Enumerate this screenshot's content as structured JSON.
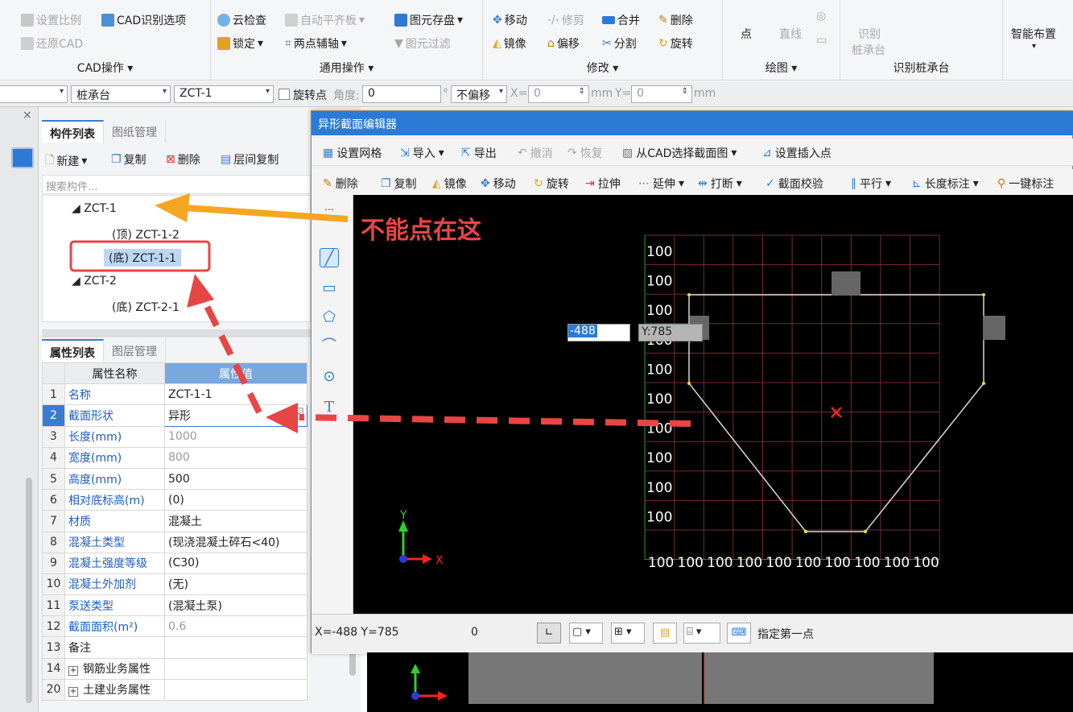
{
  "ribbon": {
    "cad_ops": {
      "set_scale": "设置比例",
      "cad_recognize_options": "CAD识别选项",
      "restore_cad": "还原CAD",
      "title": "CAD操作"
    },
    "common_ops": {
      "cloud_check": "云检查",
      "auto_align_slab": "自动平齐板",
      "lock": "锁定",
      "two_point_axis": "两点辅轴",
      "element_save": "图元存盘",
      "element_filter": "图元过滤",
      "title": "通用操作"
    },
    "modify": {
      "move": "移动",
      "trim": "修剪",
      "merge": "合并",
      "delete": "删除",
      "mirror": "镜像",
      "offset": "偏移",
      "split": "分割",
      "rotate": "旋转",
      "title": "修改"
    },
    "draw": {
      "point": "点",
      "line": "直线",
      "title": "绘图"
    },
    "recognize_cap": {
      "recognize": "识别",
      "pile_cap": "桩承台",
      "title": "识别桩承台"
    },
    "smart_layout": "智能布置"
  },
  "toolbar2": {
    "category": "桩承台",
    "element": "ZCT-1",
    "rotate_point": "旋转点",
    "angle_label": "角度:",
    "angle_value": "0",
    "degree": "°",
    "offset": "不偏移",
    "x_label": "X=",
    "x_value": "0",
    "mm1": "mm",
    "y_label": "Y=",
    "y_value": "0",
    "mm2": "mm"
  },
  "component_panel": {
    "tab_active": "构件列表",
    "tab_other": "图纸管理",
    "new": "新建",
    "copy": "复制",
    "delete": "删除",
    "layer_copy": "层间复制",
    "search_placeholder": "搜索构件...",
    "tree": [
      {
        "label": "ZCT-1"
      },
      {
        "label": "(顶) ZCT-1-2"
      },
      {
        "label": "(底) ZCT-1-1"
      },
      {
        "label": "ZCT-2"
      },
      {
        "label": "(底) ZCT-2-1"
      }
    ]
  },
  "property_panel": {
    "tab_active": "属性列表",
    "tab_other": "图层管理",
    "col_name": "属性名称",
    "col_value": "属性值",
    "rows": [
      {
        "num": "1",
        "name": "名称",
        "value": "ZCT-1-1"
      },
      {
        "num": "2",
        "name": "截面形状",
        "value": "异形"
      },
      {
        "num": "3",
        "name": "长度(mm)",
        "value": "1000"
      },
      {
        "num": "4",
        "name": "宽度(mm)",
        "value": "800"
      },
      {
        "num": "5",
        "name": "高度(mm)",
        "value": "500"
      },
      {
        "num": "6",
        "name": "相对底标高(m)",
        "value": "(0)"
      },
      {
        "num": "7",
        "name": "材质",
        "value": "混凝土"
      },
      {
        "num": "8",
        "name": "混凝土类型",
        "value": "(现浇混凝土碎石<40)"
      },
      {
        "num": "9",
        "name": "混凝土强度等级",
        "value": "(C30)"
      },
      {
        "num": "10",
        "name": "混凝土外加剂",
        "value": "(无)"
      },
      {
        "num": "11",
        "name": "泵送类型",
        "value": "(混凝土泵)"
      },
      {
        "num": "12",
        "name": "截面面积(m²)",
        "value": "0.6"
      },
      {
        "num": "13",
        "name": "备注",
        "value": ""
      },
      {
        "num": "14",
        "name": "钢筋业务属性",
        "value": ""
      },
      {
        "num": "20",
        "name": "土建业务属性",
        "value": ""
      }
    ]
  },
  "editor": {
    "title": "异形截面编辑器",
    "toolbar1": {
      "set_grid": "设置网格",
      "import": "导入",
      "export": "导出",
      "undo": "撤消",
      "redo": "恢复",
      "select_from_cad": "从CAD选择截面图",
      "set_insert_point": "设置插入点"
    },
    "toolbar2": {
      "delete": "删除",
      "copy": "复制",
      "mirror": "镜像",
      "move": "移动",
      "rotate": "旋转",
      "stretch": "拉伸",
      "extend": "延伸",
      "break": "打断",
      "section_check": "截面校验",
      "parallel": "平行",
      "length_dim": "长度标注",
      "one_key_dim": "一键标注"
    },
    "coord_input_x": "-488",
    "coord_input_y": "Y:785",
    "grid_y_labels": [
      "100",
      "100",
      "100",
      "100",
      "100",
      "100",
      "100",
      "100",
      "100",
      "100"
    ],
    "grid_x_labels": [
      "100",
      "100",
      "100",
      "100",
      "100",
      "100",
      "100",
      "100",
      "100",
      "100"
    ],
    "axis_x": "X",
    "axis_y": "Y",
    "status_coords": "X=-488 Y=785",
    "status_zero": "0",
    "status_hint": "指定第一点"
  },
  "annotation": {
    "text": "不能点在这",
    "arrow_color": "#f5a623",
    "dash_color": "#e84545",
    "highlight_color": "#e84545"
  }
}
